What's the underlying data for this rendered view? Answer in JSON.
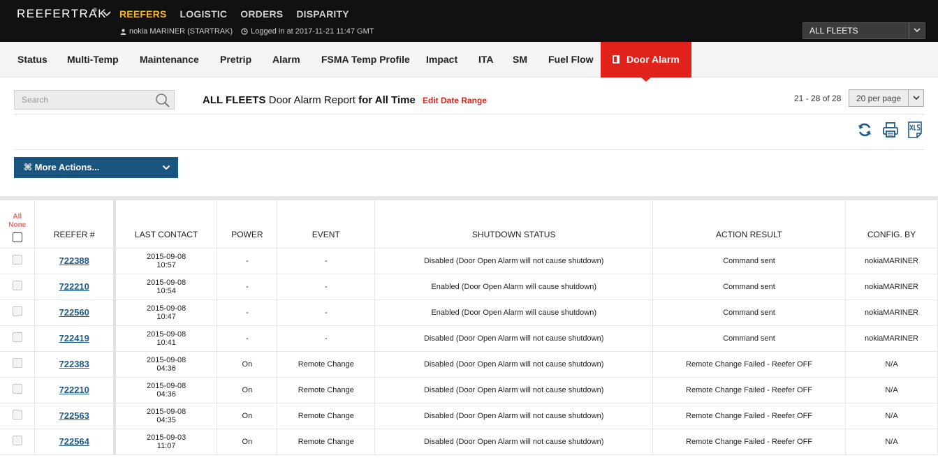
{
  "header": {
    "brand": "REEFERTRAK",
    "brand_mark": "®",
    "nav": [
      {
        "label": "REEFERS",
        "active": true
      },
      {
        "label": "LOGISTIC",
        "active": false
      },
      {
        "label": "ORDERS",
        "active": false
      },
      {
        "label": "DISPARITY",
        "active": false
      }
    ],
    "user": "nokia MARINER (STARTRAK)",
    "login_info": "Logged in at 2017-11-21 11:47 GMT",
    "fleet_select": "ALL FLEETS",
    "colors": {
      "bar": "#111111",
      "active_nav": "#f6b817"
    }
  },
  "tabs": [
    {
      "label": "Status"
    },
    {
      "label": "Multi-Temp"
    },
    {
      "label": "Maintenance"
    },
    {
      "label": "Pretrip"
    },
    {
      "label": "Alarm"
    },
    {
      "label": "FSMA Temp Profile"
    },
    {
      "label": "Impact"
    },
    {
      "label": "ITA"
    },
    {
      "label": "SM"
    },
    {
      "label": "Fuel Flow"
    },
    {
      "label": "Door Alarm",
      "active": true,
      "icon": "door-icon"
    }
  ],
  "search": {
    "placeholder": "Search",
    "value": ""
  },
  "report": {
    "fleet": "ALL FLEETS",
    "name": "Door Alarm Report",
    "for_label": "for All Time",
    "edit_link": "Edit Date Range"
  },
  "pagination": {
    "range": "21 - 28 of 28",
    "per_page": "20 per page"
  },
  "toolbar": {
    "icons": [
      "refresh-icon",
      "print-icon",
      "xls-export-icon"
    ],
    "more_actions": "⌘ More Actions..."
  },
  "table": {
    "select_all": "All",
    "select_none": "None",
    "columns": [
      "REEFER #",
      "LAST CONTACT",
      "POWER",
      "EVENT",
      "SHUTDOWN STATUS",
      "ACTION RESULT",
      "CONFIG. BY"
    ],
    "rows": [
      {
        "reefer": "722388",
        "date": "2015-09-08",
        "time": "10:57",
        "power": "-",
        "event": "-",
        "status": "Disabled (Door Open Alarm will not cause shutdown)",
        "result": "Command sent",
        "config": "nokiaMARINER"
      },
      {
        "reefer": "722210",
        "date": "2015-09-08",
        "time": "10:54",
        "power": "-",
        "event": "-",
        "status": "Enabled (Door Open Alarm will cause shutdown)",
        "result": "Command sent",
        "config": "nokiaMARINER"
      },
      {
        "reefer": "722560",
        "date": "2015-09-08",
        "time": "10:47",
        "power": "-",
        "event": "-",
        "status": "Enabled (Door Open Alarm will cause shutdown)",
        "result": "Command sent",
        "config": "nokiaMARINER"
      },
      {
        "reefer": "722419",
        "date": "2015-09-08",
        "time": "10:41",
        "power": "-",
        "event": "-",
        "status": "Disabled (Door Open Alarm will not cause shutdown)",
        "result": "Command sent",
        "config": "nokiaMARINER"
      },
      {
        "reefer": "722383",
        "date": "2015-09-08",
        "time": "04:36",
        "power": "On",
        "event": "Remote Change",
        "status": "Disabled (Door Open Alarm will not cause shutdown)",
        "result": "Remote Change Failed - Reefer OFF",
        "config": "N/A"
      },
      {
        "reefer": "722210",
        "date": "2015-09-08",
        "time": "04:36",
        "power": "On",
        "event": "Remote Change",
        "status": "Disabled (Door Open Alarm will not cause shutdown)",
        "result": "Remote Change Failed - Reefer OFF",
        "config": "N/A"
      },
      {
        "reefer": "722563",
        "date": "2015-09-08",
        "time": "04:35",
        "power": "On",
        "event": "Remote Change",
        "status": "Disabled (Door Open Alarm will not cause shutdown)",
        "result": "Remote Change Failed - Reefer OFF",
        "config": "N/A"
      },
      {
        "reefer": "722564",
        "date": "2015-09-03",
        "time": "11:07",
        "power": "On",
        "event": "Remote Change",
        "status": "Disabled (Door Open Alarm will not cause shutdown)",
        "result": "Remote Change Failed - Reefer OFF",
        "config": "N/A"
      }
    ]
  }
}
